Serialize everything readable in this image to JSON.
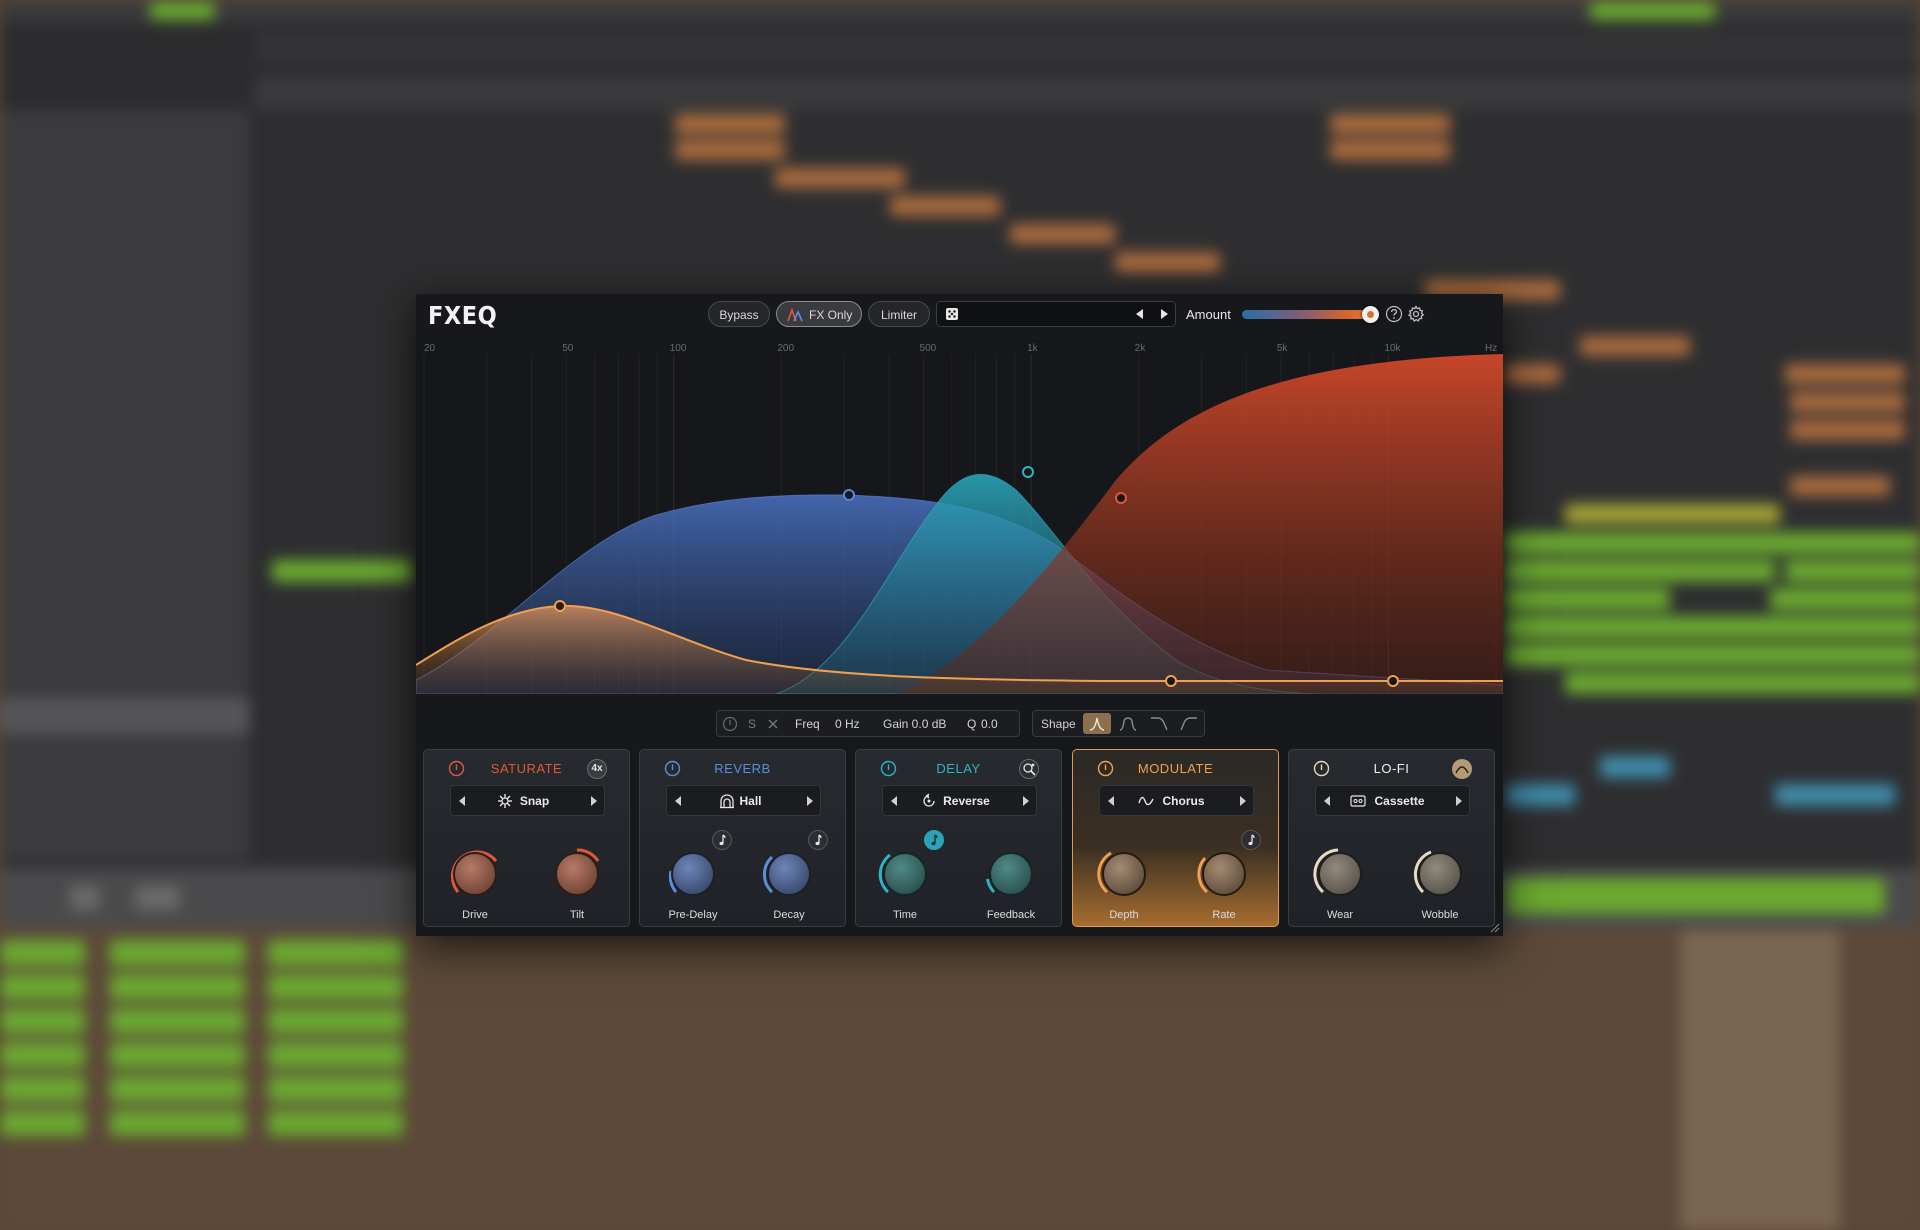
{
  "plugin": {
    "logo": "FXEQ",
    "header": {
      "bypass_label": "Bypass",
      "fxonly_label": "FX Only",
      "limiter_label": "Limiter",
      "amount_label": "Amount",
      "amount_value": 0.9
    },
    "freq_labels": [
      "20",
      "50",
      "100",
      "200",
      "500",
      "1k",
      "2k",
      "5k",
      "10k",
      "Hz"
    ],
    "band_info": {
      "solo_label": "S",
      "freq_label": "Freq",
      "freq_value": "0 Hz",
      "gain_text": "Gain 0.0 dB",
      "q_label": "Q",
      "q_value": "0.0"
    },
    "shape_label": "Shape",
    "modules": [
      {
        "title": "SATURATE",
        "extra": "4x",
        "selector": "Snap",
        "knobs": [
          "Drive",
          "Tilt"
        ],
        "color": "#e0583a"
      },
      {
        "title": "REVERB",
        "selector": "Hall",
        "knobs": [
          "Pre-Delay",
          "Decay"
        ],
        "color": "#5b8fd9"
      },
      {
        "title": "DELAY",
        "selector": "Reverse",
        "knobs": [
          "Time",
          "Feedback"
        ],
        "color": "#2fb3c7"
      },
      {
        "title": "MODULATE",
        "selector": "Chorus",
        "knobs": [
          "Depth",
          "Rate"
        ],
        "color": "#f0a04f"
      },
      {
        "title": "LO-FI",
        "selector": "Cassette",
        "knobs": [
          "Wear",
          "Wobble"
        ],
        "color": "#e6e6e6"
      }
    ],
    "colors": {
      "saturate": "#e0583a",
      "reverb": "#4a73c4",
      "delay": "#2aa3b8",
      "modulate": "#f0a04f",
      "accent_red": "#d0482a"
    }
  }
}
